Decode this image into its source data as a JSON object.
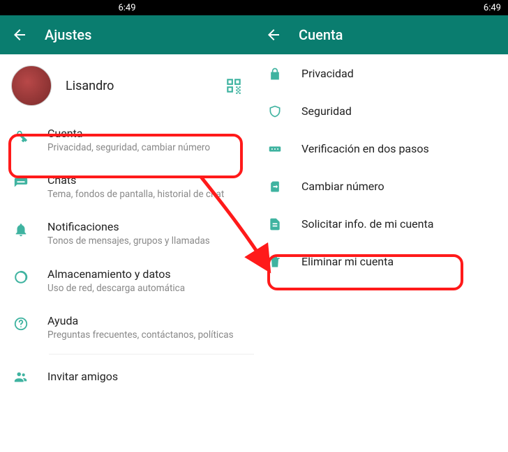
{
  "status": {
    "time": "6:49"
  },
  "left": {
    "title": "Ajustes",
    "profile": {
      "name": "Lisandro"
    },
    "items": [
      {
        "title": "Cuenta",
        "sub": "Privacidad, seguridad, cambiar número"
      },
      {
        "title": "Chats",
        "sub": "Tema, fondos de pantalla, historial de chat"
      },
      {
        "title": "Notificaciones",
        "sub": "Tonos de mensajes, grupos y llamadas"
      },
      {
        "title": "Almacenamiento y datos",
        "sub": "Uso de red, descarga automática"
      },
      {
        "title": "Ayuda",
        "sub": "Preguntas frecuentes, contáctanos, políticas"
      },
      {
        "title": "Invitar amigos"
      }
    ]
  },
  "right": {
    "title": "Cuenta",
    "items": [
      {
        "title": "Privacidad"
      },
      {
        "title": "Seguridad"
      },
      {
        "title": "Verificación en dos pasos"
      },
      {
        "title": "Cambiar número"
      },
      {
        "title": "Solicitar info. de mi cuenta"
      },
      {
        "title": "Eliminar mi cuenta"
      }
    ]
  },
  "annotations": {
    "highlight_left_item": 0,
    "highlight_right_item": 5
  },
  "colors": {
    "primary": "#0a7d6f",
    "accent": "#3fb3a0",
    "highlight": "#ff1a1a"
  }
}
